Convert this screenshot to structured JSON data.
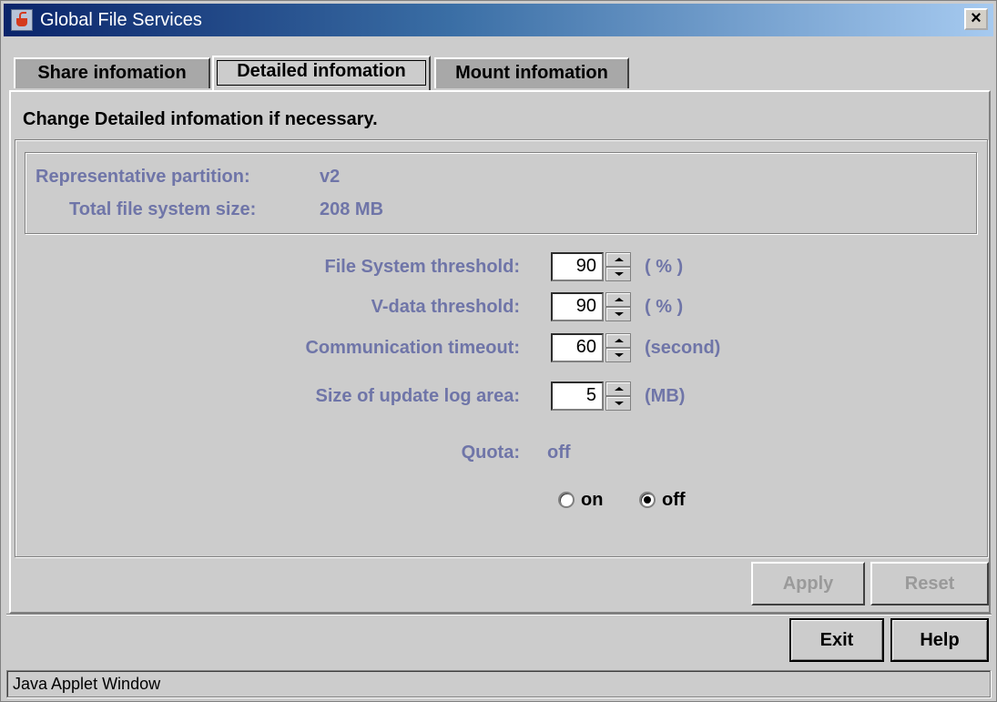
{
  "window": {
    "title": "Global File Services",
    "close_label": "×"
  },
  "tabs": [
    {
      "label": "Share infomation",
      "active": false
    },
    {
      "label": "Detailed infomation",
      "active": true
    },
    {
      "label": "Mount infomation",
      "active": false
    }
  ],
  "instruction": "Change Detailed infomation if necessary.",
  "info": {
    "partition_label": "Representative partition:",
    "partition_value": "v2",
    "size_label": "Total file system size:",
    "size_value": "208 MB"
  },
  "settings": [
    {
      "label": "File System threshold:",
      "value": "90",
      "unit": "( % )"
    },
    {
      "label": "V-data threshold:",
      "value": "90",
      "unit": "( % )"
    },
    {
      "label": "Communication timeout:",
      "value": "60",
      "unit": "(second)"
    },
    {
      "label": "Size of update log area:",
      "value": "5",
      "unit": "(MB)"
    }
  ],
  "quota": {
    "label": "Quota:",
    "value": "off",
    "options": [
      "on",
      "off"
    ],
    "selected": "off"
  },
  "buttons": {
    "apply": "Apply",
    "reset": "Reset",
    "exit": "Exit",
    "help": "Help"
  },
  "status_bar": "Java Applet Window",
  "colors": {
    "label_text": "#6f75a8",
    "titlebar_start": "#0a246a",
    "titlebar_end": "#a6caf0"
  }
}
